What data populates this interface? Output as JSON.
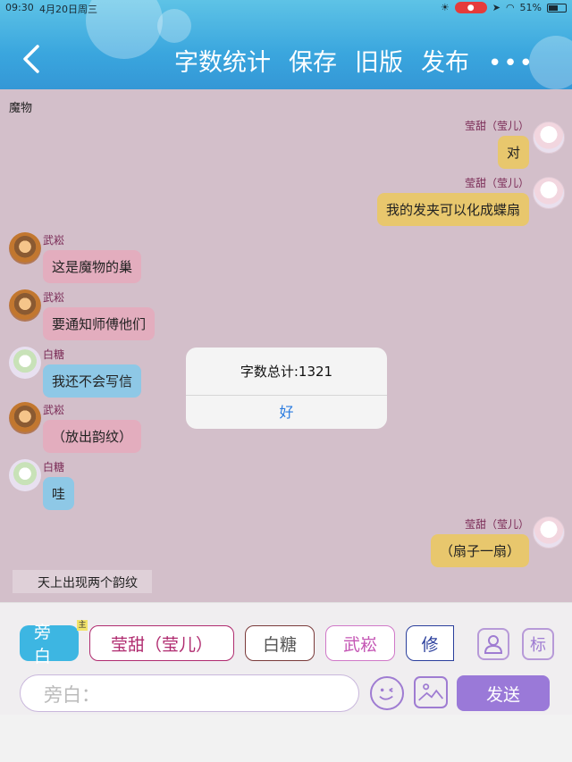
{
  "status_bar": {
    "time": "09:30",
    "date": "4月20日周三",
    "battery": "51%"
  },
  "header": {
    "nav": [
      "字数统计",
      "保存",
      "旧版",
      "发布"
    ],
    "more": "•••"
  },
  "chat": {
    "scene_title": "魔物",
    "messages": [
      {
        "side": "right",
        "name": "莹甜（莹儿）",
        "text": "对",
        "color": "#e8c76d"
      },
      {
        "side": "right",
        "name": "莹甜（莹儿）",
        "text": "我的发夹可以化成蝶扇",
        "color": "#e8c76d"
      },
      {
        "side": "left",
        "name": "武崧",
        "text": "这是魔物的巢",
        "color": "#e3adbe"
      },
      {
        "side": "left",
        "name": "武崧",
        "text": "要通知师傅他们",
        "color": "#e3adbe"
      },
      {
        "side": "left",
        "name": "白糖",
        "text": "我还不会写信",
        "color": "#8ec8e6"
      },
      {
        "side": "left",
        "name": "武崧",
        "text": "（放出韵纹）",
        "color": "#e3adbe"
      },
      {
        "side": "left",
        "name": "白糖",
        "text": "哇",
        "color": "#8ec8e6"
      },
      {
        "side": "right",
        "name": "莹甜（莹儿）",
        "text": "（扇子一扇）",
        "color": "#e8c76d"
      }
    ],
    "narration": "天上出现两个韵纹"
  },
  "alert": {
    "title": "字数总计:1321",
    "ok": "好"
  },
  "composer": {
    "tabs": [
      "旁白",
      "莹甜（莹儿）",
      "白糖",
      "武崧",
      "修"
    ],
    "badge": "主",
    "icon_labels": [
      "标"
    ],
    "input_placeholder": "旁白：",
    "send": "发送"
  }
}
